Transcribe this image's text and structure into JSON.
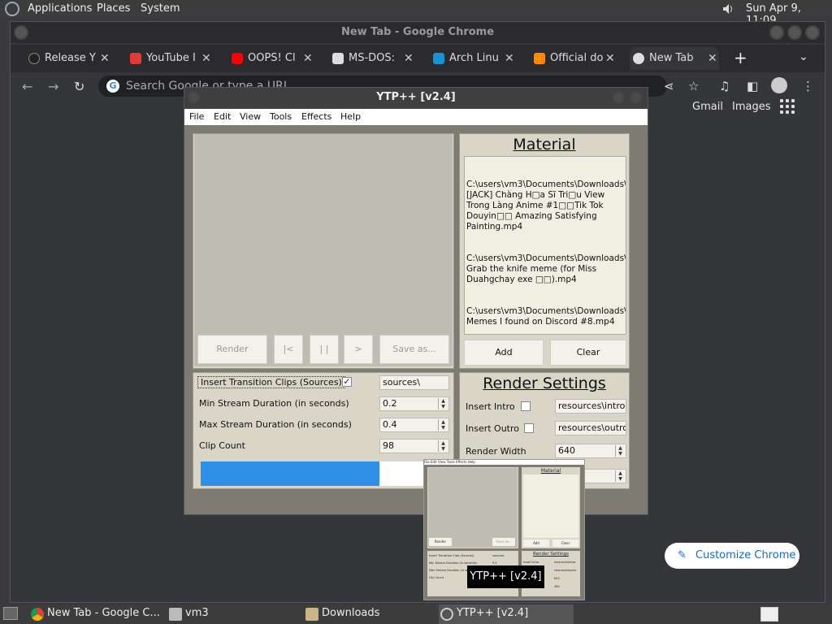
{
  "top_panel": {
    "menus": [
      "Applications",
      "Places",
      "System"
    ],
    "clock": "Sun Apr  9, 11:09"
  },
  "chrome": {
    "title": "New Tab - Google Chrome",
    "tabs": [
      {
        "label": "Release Y",
        "icon": "github-icon",
        "color": "#222222"
      },
      {
        "label": "YouTube I",
        "icon": "youtube-download-icon",
        "color": "#e53935"
      },
      {
        "label": "OOPS! Cl",
        "icon": "youtube-icon",
        "color": "#ff0000"
      },
      {
        "label": "MS-DOS:",
        "icon": "archive-org-icon",
        "color": "#dddddd"
      },
      {
        "label": "Arch Linu",
        "icon": "arch-linux-icon",
        "color": "#1793d1"
      },
      {
        "label": "Official do",
        "icon": "vlc-icon",
        "color": "#ff8800"
      },
      {
        "label": "New Tab",
        "icon": "chrome-icon",
        "color": "#dddddd"
      }
    ],
    "omnibox_placeholder": "Search Google or type a URL",
    "links": {
      "gmail": "Gmail",
      "images": "Images"
    },
    "customize": "Customize Chrome"
  },
  "ytp": {
    "title": "YTP++ [v2.4]",
    "menu": [
      "File",
      "Edit",
      "View",
      "Tools",
      "Effects",
      "Help"
    ],
    "controls": {
      "render": "Render",
      "start": "|<",
      "pause": "| |",
      "play": ">",
      "save": "Save as..."
    },
    "material": {
      "title": "Material",
      "items": [
        "C:\\users\\vm3\\Documents\\Downloads\\\n[JACK] Chàng H□a Sĩ Tri□u View\nTrong Làng Anime #1□□Tik Tok\nDouyin□□ Amazing Satisfying\nPainting.mp4",
        "C:\\users\\vm3\\Documents\\Downloads\\\nGrab the knife meme (for Miss\nDuahgchay exe □□).mp4",
        "C:\\users\\vm3\\Documents\\Downloads\\\nMemes I found on Discord #8.mp4"
      ],
      "add": "Add",
      "clear": "Clear"
    },
    "settings": {
      "transition_label": "Insert Transition Clips (Sources)",
      "transition_checked": "✓",
      "transition_value": "sources\\",
      "min_label": "Min Stream Duration (in seconds)",
      "min_value": "0.2",
      "max_label": "Max Stream Duration (in seconds)",
      "max_value": "0.4",
      "count_label": "Clip Count",
      "count_value": "98",
      "progress": 0.72
    },
    "render": {
      "title": "Render Settings",
      "intro_label": "Insert Intro",
      "intro_value": "resources\\intro.m",
      "outro_label": "Insert Outro",
      "outro_value": "resources\\outro.m",
      "width_label": "Render Width",
      "width_value": "640"
    },
    "thumb": {
      "menu": [
        "File",
        "Edit",
        "View",
        "Tools",
        "Effects",
        "Help"
      ],
      "material": "Material",
      "render_settings": "Render Settings",
      "render": "Render",
      "save": "Save as...",
      "add": "Add",
      "clear": "Clear",
      "rows": [
        "Insert Transition Clips (Sources)",
        "Min Stream Duration (in seconds)",
        "Max Stream Duration (in seconds)",
        "Clip Count"
      ],
      "values": [
        "sources\\",
        "0.2",
        "0.4",
        "98"
      ],
      "render_rows": [
        "Insert Intro",
        "Insert Outro",
        "Render Width",
        "Render Height"
      ],
      "render_values": [
        "resources\\intro",
        "resources\\outro",
        "640",
        "480"
      ]
    },
    "tooltip": "YTP++ [v2.4]"
  },
  "taskbar": [
    {
      "label": "New Tab - Google C...",
      "icon": "chrome-icon"
    },
    {
      "label": "vm3",
      "icon": "home-folder-icon"
    },
    {
      "label": "Downloads",
      "icon": "folder-icon"
    },
    {
      "label": "YTP++ [v2.4]",
      "icon": "ytp-icon"
    }
  ]
}
